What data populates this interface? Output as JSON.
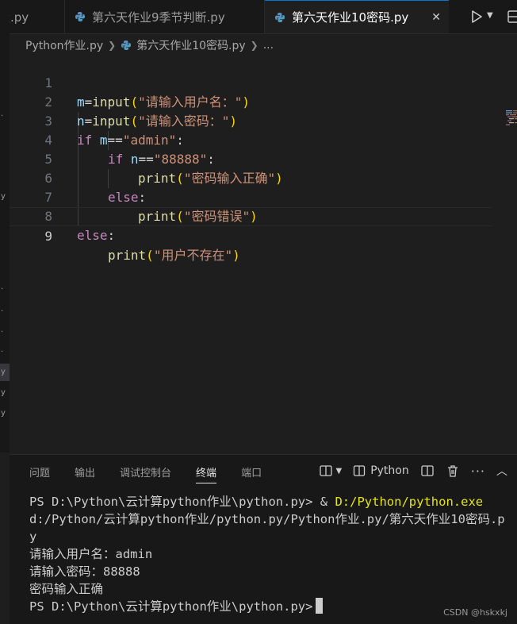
{
  "tabs": [
    {
      "label": "量.py",
      "active": false
    },
    {
      "label": "第六天作业9季节判断.py",
      "active": false
    },
    {
      "label": "第六天作业10密码.py",
      "active": true
    }
  ],
  "breadcrumb": {
    "folder": "Python作业.py",
    "file": "第六天作业10密码.py",
    "more": "..."
  },
  "editor": {
    "active_line": 9,
    "lines": [
      {
        "n": "1",
        "v": "m",
        "op": "=",
        "f": "input",
        "po": "(",
        "s": "\"请输入用户名：\"",
        "pc": ")"
      },
      {
        "n": "2",
        "v": "n",
        "op": "=",
        "f": "input",
        "po": "(",
        "s": "\"请输入密码：\"",
        "pc": ")"
      },
      {
        "n": "3",
        "kw": "if",
        "sp": " ",
        "v": "m",
        "op": "==",
        "s": "\"admin\"",
        "colon": ":"
      },
      {
        "n": "4",
        "kw": "if",
        "sp": " ",
        "v": "n",
        "op": "==",
        "s": "\"88888\"",
        "colon": ":"
      },
      {
        "n": "5",
        "f": "print",
        "po": "(",
        "s": "\"密码输入正确\"",
        "pc": ")"
      },
      {
        "n": "6",
        "kw": "else",
        "colon": ":"
      },
      {
        "n": "7",
        "f": "print",
        "po": "(",
        "s": "\"密码错误\"",
        "pc": ")"
      },
      {
        "n": "8",
        "kw": "else",
        "colon": ":"
      },
      {
        "n": "9",
        "f": "print",
        "po": "(",
        "s": "\"用户不存在\"",
        "pc": ")"
      }
    ]
  },
  "panel": {
    "tabs": [
      {
        "label": "问题",
        "active": false
      },
      {
        "label": "输出",
        "active": false
      },
      {
        "label": "调试控制台",
        "active": false
      },
      {
        "label": "终端",
        "active": true
      },
      {
        "label": "端口",
        "active": false
      }
    ],
    "terminal_kind": "Python",
    "terminal": {
      "prompt1": "PS D:\\Python\\云计算python作业\\python.py> ",
      "cmd_amp": "& ",
      "cmd_exe": "D:/Python/python.exe",
      "cmd_arg": " d:/Python/云计算python作业/python.py/Python作业.py/第六天作业10密码.py",
      "out1": "请输入用户名：admin",
      "out2": "请输入密码：88888",
      "out3": "密码输入正确",
      "prompt2": "PS D:\\Python\\云计算python作业\\python.py>"
    }
  },
  "watermark": "CSDN @hskxkj",
  "colors": {
    "keyword": "#569cd6",
    "control": "#c586c0",
    "variable": "#9cdcfe",
    "function": "#dcdcaa",
    "string": "#ce9178",
    "bracket": "#ffd700",
    "exe_path": "#e5e510",
    "accent": "#0078d4"
  }
}
